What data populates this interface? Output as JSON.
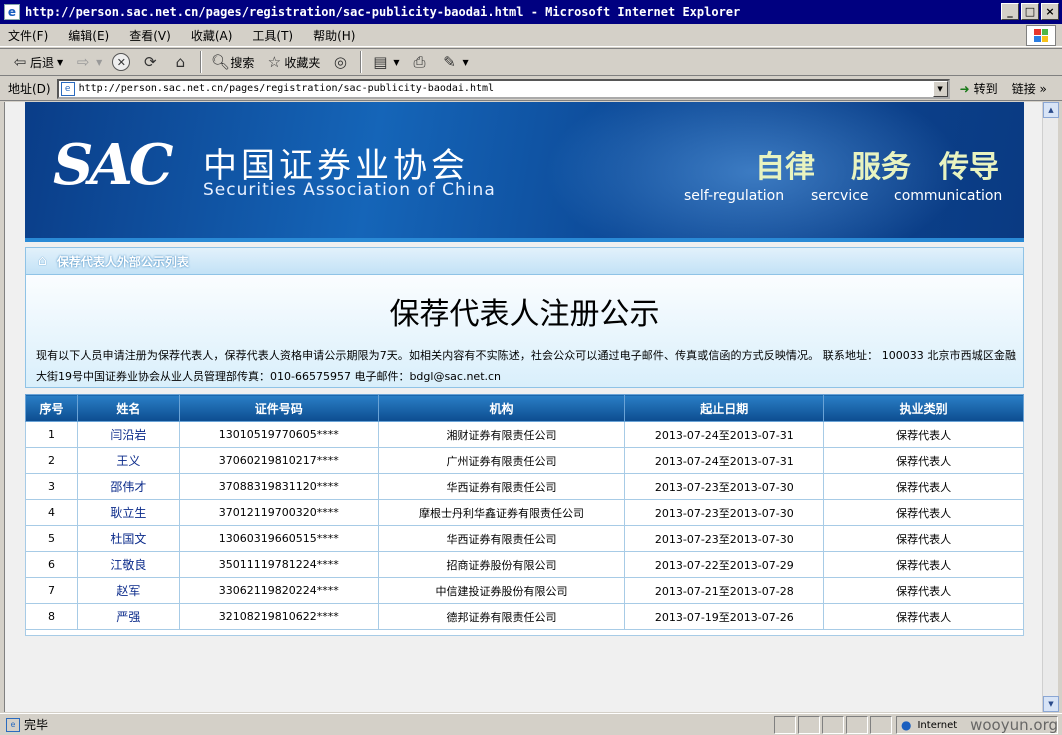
{
  "window": {
    "title": "http://person.sac.net.cn/pages/registration/sac-publicity-baodai.html - Microsoft Internet Explorer"
  },
  "menu": [
    "文件(F)",
    "编辑(E)",
    "查看(V)",
    "收藏(A)",
    "工具(T)",
    "帮助(H)"
  ],
  "toolbar": {
    "back": "后退",
    "search": "搜索",
    "favorites": "收藏夹"
  },
  "address": {
    "label": "地址(D)",
    "url": "http://person.sac.net.cn/pages/registration/sac-publicity-baodai.html",
    "go": "转到",
    "links": "链接"
  },
  "banner": {
    "logo": "SAC",
    "org_cn": "中国证券业协会",
    "org_en": "Securities Association of China",
    "slogans": [
      {
        "cn": "自律",
        "en": "self-regulation"
      },
      {
        "cn": "服务",
        "en": "sercvice"
      },
      {
        "cn": "传导",
        "en": "communication"
      }
    ]
  },
  "breadcrumb": "保荐代表人外部公示列表",
  "notice": {
    "title": "保荐代表人注册公示",
    "text": "现有以下人员申请注册为保荐代表人，保荐代表人资格申请公示期限为7天。如相关内容有不实陈述，社会公众可以通过电子邮件、传真或信函的方式反映情况。 联系地址： 100033 北京市西城区金融大街19号中国证券业协会从业人员管理部传真：010-66575957 电子邮件：bdgl@sac.net.cn"
  },
  "table": {
    "headers": [
      "序号",
      "姓名",
      "证件号码",
      "机构",
      "起止日期",
      "执业类别"
    ],
    "rows": [
      [
        "1",
        "闫沿岩",
        "13010519770605****",
        "湘财证券有限责任公司",
        "2013-07-24至2013-07-31",
        "保荐代表人"
      ],
      [
        "2",
        "王义",
        "37060219810217****",
        "广州证券有限责任公司",
        "2013-07-24至2013-07-31",
        "保荐代表人"
      ],
      [
        "3",
        "邵伟才",
        "37088319831120****",
        "华西证券有限责任公司",
        "2013-07-23至2013-07-30",
        "保荐代表人"
      ],
      [
        "4",
        "耿立生",
        "37012119700320****",
        "摩根士丹利华鑫证券有限责任公司",
        "2013-07-23至2013-07-30",
        "保荐代表人"
      ],
      [
        "5",
        "杜国文",
        "13060319660515****",
        "华西证券有限责任公司",
        "2013-07-23至2013-07-30",
        "保荐代表人"
      ],
      [
        "6",
        "江敬良",
        "35011119781224****",
        "招商证券股份有限公司",
        "2013-07-22至2013-07-29",
        "保荐代表人"
      ],
      [
        "7",
        "赵军",
        "33062119820224****",
        "中信建投证券股份有限公司",
        "2013-07-21至2013-07-28",
        "保荐代表人"
      ],
      [
        "8",
        "严强",
        "32108219810622****",
        "德邦证券有限责任公司",
        "2013-07-19至2013-07-26",
        "保荐代表人"
      ]
    ]
  },
  "status": {
    "text": "完毕",
    "zone": "Internet",
    "watermark": "wooyun.org"
  },
  "colors": {
    "title_bar": "#000080",
    "banner": "#1565b8",
    "table_header": "#1a66b0",
    "link_name": "#0a2a8a"
  }
}
